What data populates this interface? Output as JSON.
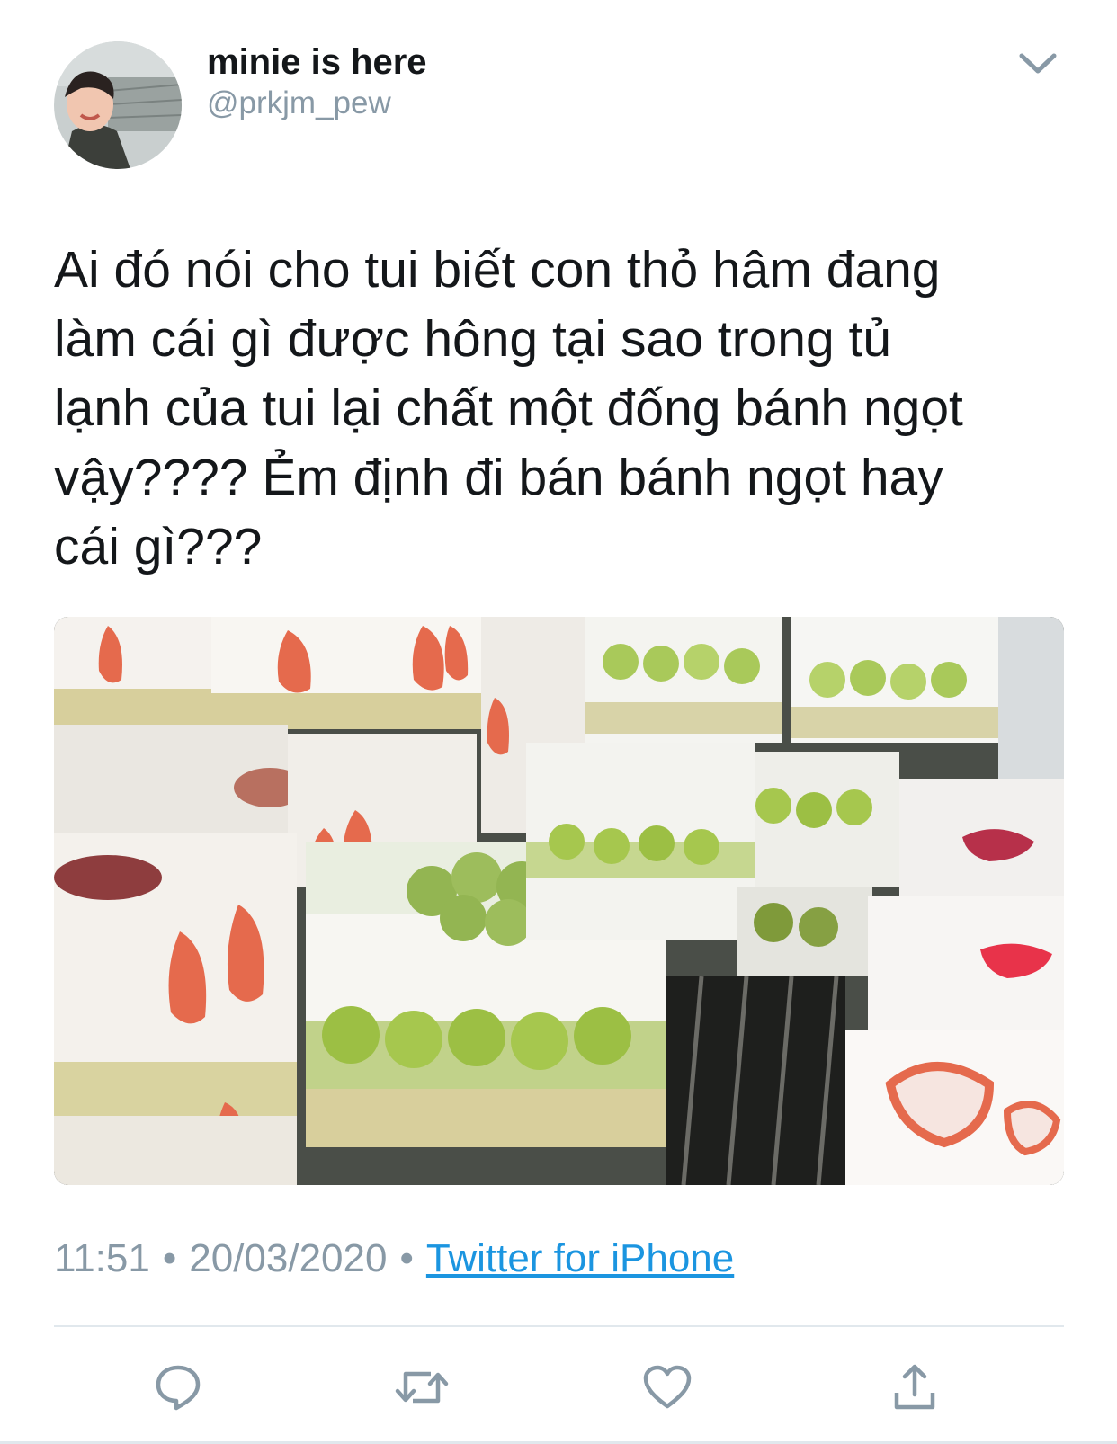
{
  "user": {
    "display_name": "minie is here",
    "handle": "@prkjm_pew"
  },
  "tweet": {
    "text": "Ai đó nói cho tui biết con thỏ hâm đang\nlàm cái gì được hông tại sao trong tủ\nlạnh của tui lại chất một đống bánh ngọt\nvậy???? Ẻm định đi bán bánh ngọt hay\ncái gì???"
  },
  "meta": {
    "time": "11:51",
    "separator": "•",
    "date": "20/03/2020",
    "source": "Twitter for iPhone"
  },
  "icons": {
    "chevron": "chevron-down-icon",
    "reply": "reply-icon",
    "retweet": "retweet-icon",
    "like": "heart-icon",
    "share": "share-icon"
  },
  "colors": {
    "text": "#14171a",
    "secondary": "#8899a6",
    "link": "#1b95e0",
    "divider": "#e1e8ed"
  }
}
